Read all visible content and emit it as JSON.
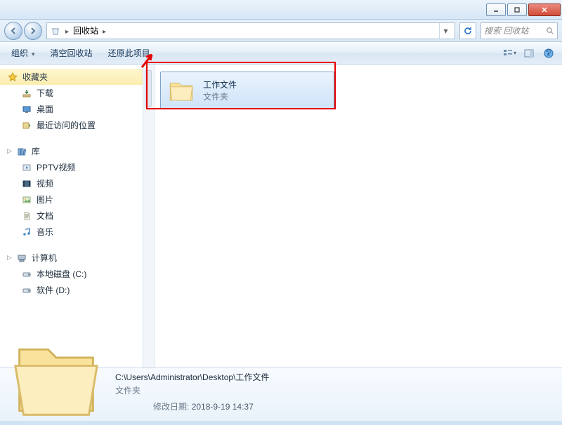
{
  "titlebar": {},
  "address": {
    "location_label": "回收站",
    "search_placeholder": "搜索 回收站"
  },
  "toolbar": {
    "organize": "组织",
    "empty_bin": "清空回收站",
    "restore_item": "还原此项目"
  },
  "nav": {
    "favorites": {
      "label": "收藏夹",
      "items": [
        "下载",
        "桌面",
        "最近访问的位置"
      ]
    },
    "libraries": {
      "label": "库",
      "items": [
        "PPTV视频",
        "视频",
        "图片",
        "文档",
        "音乐"
      ]
    },
    "computer": {
      "label": "计算机",
      "items": [
        "本地磁盘 (C:)",
        "软件 (D:)"
      ]
    }
  },
  "content": {
    "item": {
      "name": "工作文件",
      "type": "文件夹"
    }
  },
  "details": {
    "path": "C:\\Users\\Administrator\\Desktop\\工作文件",
    "type": "文件夹",
    "date_label": "修改日期:",
    "date_value": "2018-9-19 14:37"
  }
}
